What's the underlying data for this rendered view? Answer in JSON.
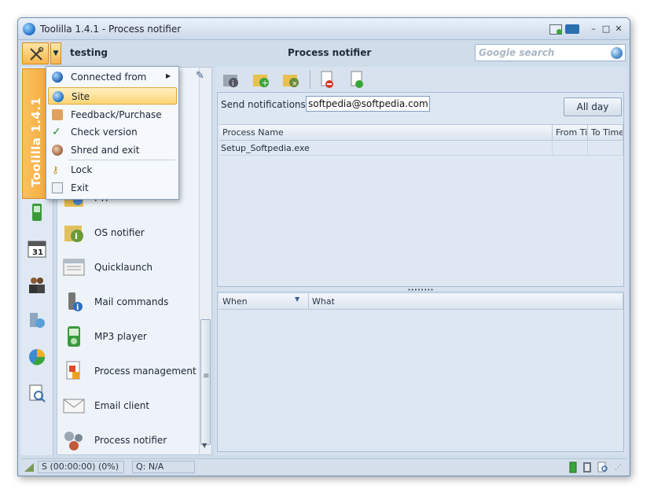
{
  "window": {
    "title": "Toolilla 1.4.1 - Process notifier",
    "controls": [
      "–",
      "□",
      "✕"
    ]
  },
  "toolbar": {
    "left_label": "testing",
    "center_label": "Process notifier",
    "search_placeholder": "Google search"
  },
  "sidebar": {
    "vertical_tab": "Toolilla 1.4.1"
  },
  "list": {
    "items": [
      {
        "label": "FTP"
      },
      {
        "label": "OS notifier"
      },
      {
        "label": "Quicklaunch"
      },
      {
        "label": "Mail commands"
      },
      {
        "label": "MP3 player"
      },
      {
        "label": "Process management"
      },
      {
        "label": "Email client"
      },
      {
        "label": "Process notifier"
      }
    ]
  },
  "menu": {
    "items": [
      {
        "label": "Connected from",
        "has_submenu": true
      },
      {
        "label": "Site",
        "selected": true
      },
      {
        "label": "Feedback/Purchase"
      },
      {
        "label": "Check version"
      },
      {
        "label": "Shred and exit"
      },
      {
        "label": "Lock"
      },
      {
        "label": "Exit"
      }
    ]
  },
  "notifier": {
    "send_label": "Send notifications to:",
    "email_value": "softpedia@softpedia.com",
    "allday_label": "All day",
    "process_columns": [
      "Process Name",
      "From Time",
      "To Time"
    ],
    "process_rows": [
      {
        "name": "Setup_Softpedia.exe",
        "from": "",
        "to": ""
      }
    ],
    "log_columns": [
      "When",
      "What"
    ]
  },
  "status": {
    "session": "S (00:00:00) (0%)",
    "queue": "Q: N/A"
  },
  "colors": {
    "accent_orange": "#f6a73b",
    "panel_blue": "#d7e2ee",
    "selection": "#fbd576"
  }
}
